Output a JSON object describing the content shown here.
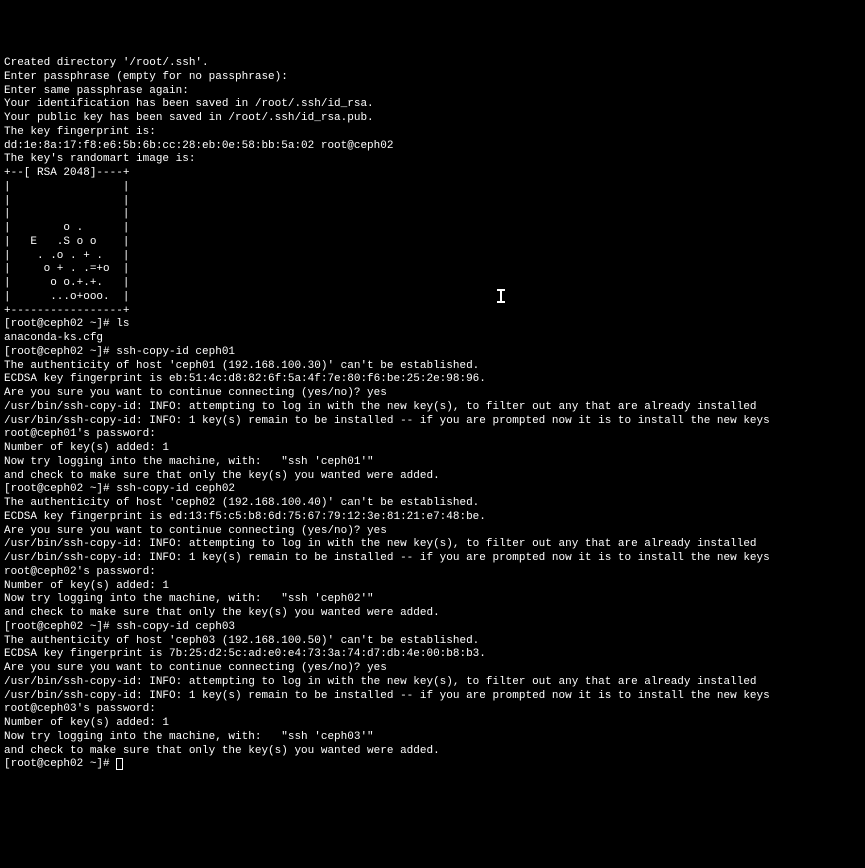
{
  "terminal": {
    "lines": [
      "Created directory '/root/.ssh'.",
      "Enter passphrase (empty for no passphrase):",
      "Enter same passphrase again:",
      "Your identification has been saved in /root/.ssh/id_rsa.",
      "Your public key has been saved in /root/.ssh/id_rsa.pub.",
      "The key fingerprint is:",
      "dd:1e:8a:17:f8:e6:5b:6b:cc:28:eb:0e:58:bb:5a:02 root@ceph02",
      "The key's randomart image is:",
      "+--[ RSA 2048]----+",
      "|                 |",
      "|                 |",
      "|                 |",
      "|        o .      |",
      "|   E   .S o o    |",
      "|    . .o . + .   |",
      "|     o + . .=+o  |",
      "|      o o.+.+.   |",
      "|      ...o+ooo.  |",
      "+-----------------+",
      "[root@ceph02 ~]# ls",
      "anaconda-ks.cfg",
      "[root@ceph02 ~]# ssh-copy-id ceph01",
      "The authenticity of host 'ceph01 (192.168.100.30)' can't be established.",
      "ECDSA key fingerprint is eb:51:4c:d8:82:6f:5a:4f:7e:80:f6:be:25:2e:98:96.",
      "Are you sure you want to continue connecting (yes/no)? yes",
      "/usr/bin/ssh-copy-id: INFO: attempting to log in with the new key(s), to filter out any that are already installed",
      "/usr/bin/ssh-copy-id: INFO: 1 key(s) remain to be installed -- if you are prompted now it is to install the new keys",
      "root@ceph01's password:",
      "",
      "Number of key(s) added: 1",
      "",
      "Now try logging into the machine, with:   \"ssh 'ceph01'\"",
      "and check to make sure that only the key(s) you wanted were added.",
      "",
      "[root@ceph02 ~]# ssh-copy-id ceph02",
      "The authenticity of host 'ceph02 (192.168.100.40)' can't be established.",
      "ECDSA key fingerprint is ed:13:f5:c5:b8:6d:75:67:79:12:3e:81:21:e7:48:be.",
      "Are you sure you want to continue connecting (yes/no)? yes",
      "/usr/bin/ssh-copy-id: INFO: attempting to log in with the new key(s), to filter out any that are already installed",
      "/usr/bin/ssh-copy-id: INFO: 1 key(s) remain to be installed -- if you are prompted now it is to install the new keys",
      "root@ceph02's password:",
      "",
      "Number of key(s) added: 1",
      "",
      "Now try logging into the machine, with:   \"ssh 'ceph02'\"",
      "and check to make sure that only the key(s) you wanted were added.",
      "",
      "[root@ceph02 ~]# ssh-copy-id ceph03",
      "The authenticity of host 'ceph03 (192.168.100.50)' can't be established.",
      "ECDSA key fingerprint is 7b:25:d2:5c:ad:e0:e4:73:3a:74:d7:db:4e:00:b8:b3.",
      "Are you sure you want to continue connecting (yes/no)? yes",
      "/usr/bin/ssh-copy-id: INFO: attempting to log in with the new key(s), to filter out any that are already installed",
      "/usr/bin/ssh-copy-id: INFO: 1 key(s) remain to be installed -- if you are prompted now it is to install the new keys",
      "root@ceph03's password:",
      "",
      "Number of key(s) added: 1",
      "",
      "Now try logging into the machine, with:   \"ssh 'ceph03'\"",
      "and check to make sure that only the key(s) you wanted were added.",
      ""
    ],
    "prompt": "[root@ceph02 ~]# "
  }
}
